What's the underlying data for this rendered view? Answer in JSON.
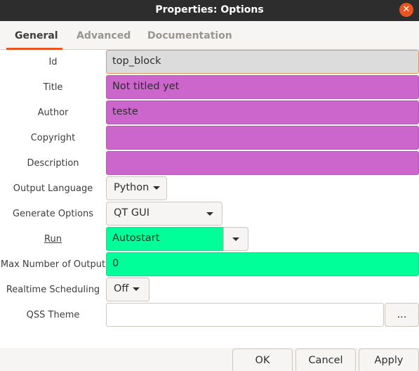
{
  "window": {
    "title": "Properties: Options",
    "close_glyph": "✕"
  },
  "tabs": [
    {
      "label": "General",
      "active": true
    },
    {
      "label": "Advanced",
      "active": false
    },
    {
      "label": "Documentation",
      "active": false
    }
  ],
  "fields": {
    "id": {
      "label": "Id",
      "value": "top_block"
    },
    "title": {
      "label": "Title",
      "value": "Not titled yet"
    },
    "author": {
      "label": "Author",
      "value": "teste"
    },
    "copyright": {
      "label": "Copyright",
      "value": ""
    },
    "description": {
      "label": "Description",
      "value": ""
    },
    "output_language": {
      "label": "Output Language",
      "value": "Python"
    },
    "generate_options": {
      "label": "Generate Options",
      "value": "QT GUI"
    },
    "run": {
      "label": "Run",
      "value": "Autostart"
    },
    "max_outputs": {
      "label": "Max Number of Output",
      "value": "0"
    },
    "realtime": {
      "label": "Realtime Scheduling",
      "value": "Off"
    },
    "qss_theme": {
      "label": "QSS Theme",
      "value": "",
      "browse_label": "..."
    }
  },
  "buttons": {
    "ok": "OK",
    "cancel": "Cancel",
    "apply": "Apply"
  },
  "colors": {
    "titlebar": "#2d2d2d",
    "accent": "#e95420",
    "string_param": "#cc66cc",
    "numeric_param": "#00ff99",
    "id_field": "#dcdcdc"
  }
}
